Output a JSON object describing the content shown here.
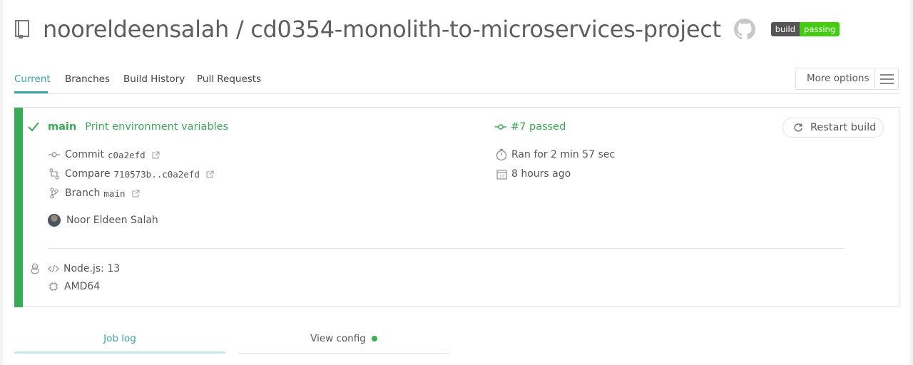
{
  "repo": {
    "title": "nooreldeensalah / cd0354-monolith-to-microservices-project",
    "badge_left": "build",
    "badge_right": "passing"
  },
  "tabs": [
    {
      "label": "Current",
      "active": true
    },
    {
      "label": "Branches",
      "active": false
    },
    {
      "label": "Build History",
      "active": false
    },
    {
      "label": "Pull Requests",
      "active": false
    }
  ],
  "more_options": {
    "label": "More options"
  },
  "build": {
    "status": "passed",
    "branch": "main",
    "message": "Print environment variables",
    "number": "#7 passed",
    "commit_label": "Commit",
    "commit_hash": "c0a2efd",
    "compare_label": "Compare",
    "compare_range": "710573b..c0a2efd",
    "branch_label": "Branch",
    "branch_value": "main",
    "author": "Noor Eldeen Salah",
    "duration": "Ran for 2 min 57 sec",
    "finished": "8 hours ago",
    "restart_label": "Restart build",
    "language": "Node.js: 13",
    "arch": "AMD64",
    "status_color": "#39aa56"
  },
  "bottom_tabs": {
    "job_log": "Job log",
    "view_config": "View config"
  },
  "colors": {
    "accent": "#3ba6a6",
    "passed": "#39aa56"
  }
}
